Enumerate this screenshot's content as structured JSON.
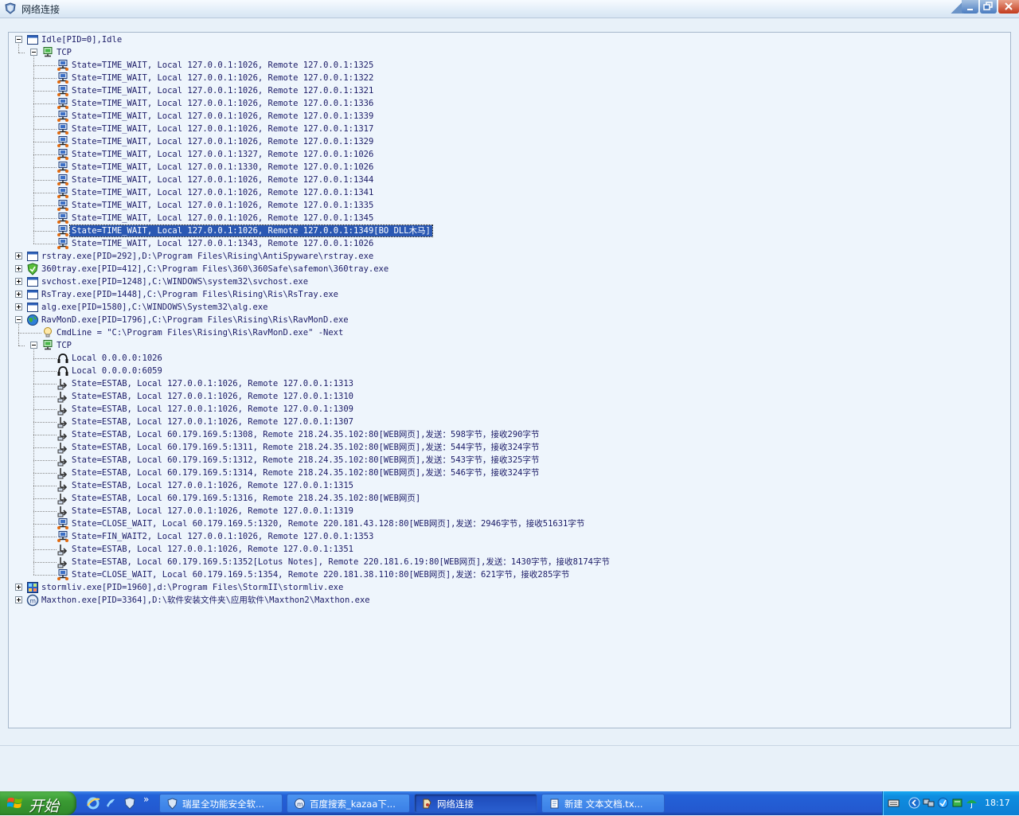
{
  "window": {
    "title": "网络连接"
  },
  "tree": [
    {
      "id": "idle",
      "depth": 0,
      "expander": "minus",
      "icon": "window-icon",
      "label": "Idle[PID=0],Idle"
    },
    {
      "id": "idle-tcp",
      "depth": 1,
      "expander": "minus",
      "icon": "network-icon",
      "label": "TCP"
    },
    {
      "depth": 2,
      "icon": "connection-icon",
      "label": "State=TIME_WAIT, Local 127.0.0.1:1026, Remote 127.0.0.1:1325"
    },
    {
      "depth": 2,
      "icon": "connection-icon",
      "label": "State=TIME_WAIT, Local 127.0.0.1:1026, Remote 127.0.0.1:1322"
    },
    {
      "depth": 2,
      "icon": "connection-icon",
      "label": "State=TIME_WAIT, Local 127.0.0.1:1026, Remote 127.0.0.1:1321"
    },
    {
      "depth": 2,
      "icon": "connection-icon",
      "label": "State=TIME_WAIT, Local 127.0.0.1:1026, Remote 127.0.0.1:1336"
    },
    {
      "depth": 2,
      "icon": "connection-icon",
      "label": "State=TIME_WAIT, Local 127.0.0.1:1026, Remote 127.0.0.1:1339"
    },
    {
      "depth": 2,
      "icon": "connection-icon",
      "label": "State=TIME_WAIT, Local 127.0.0.1:1026, Remote 127.0.0.1:1317"
    },
    {
      "depth": 2,
      "icon": "connection-icon",
      "label": "State=TIME_WAIT, Local 127.0.0.1:1026, Remote 127.0.0.1:1329"
    },
    {
      "depth": 2,
      "icon": "connection-icon",
      "label": "State=TIME_WAIT, Local 127.0.0.1:1327, Remote 127.0.0.1:1026"
    },
    {
      "depth": 2,
      "icon": "connection-icon",
      "label": "State=TIME_WAIT, Local 127.0.0.1:1330, Remote 127.0.0.1:1026"
    },
    {
      "depth": 2,
      "icon": "connection-icon",
      "label": "State=TIME_WAIT, Local 127.0.0.1:1026, Remote 127.0.0.1:1344"
    },
    {
      "depth": 2,
      "icon": "connection-icon",
      "label": "State=TIME_WAIT, Local 127.0.0.1:1026, Remote 127.0.0.1:1341"
    },
    {
      "depth": 2,
      "icon": "connection-icon",
      "label": "State=TIME_WAIT, Local 127.0.0.1:1026, Remote 127.0.0.1:1335"
    },
    {
      "depth": 2,
      "icon": "connection-icon",
      "label": "State=TIME_WAIT, Local 127.0.0.1:1026, Remote 127.0.0.1:1345"
    },
    {
      "depth": 2,
      "icon": "connection-icon",
      "label": "State=TIME_WAIT, Local 127.0.0.1:1026, Remote 127.0.0.1:1349[BO DLL木马]",
      "selected": true
    },
    {
      "depth": 2,
      "icon": "connection-icon",
      "label": "State=TIME_WAIT, Local 127.0.0.1:1343, Remote 127.0.0.1:1026"
    },
    {
      "depth": 0,
      "expander": "plus",
      "icon": "window-icon",
      "label": "rstray.exe[PID=292],D:\\Program Files\\Rising\\AntiSpyware\\rstray.exe"
    },
    {
      "depth": 0,
      "expander": "plus",
      "icon": "shield-icon",
      "label": "360tray.exe[PID=412],C:\\Program Files\\360\\360Safe\\safemon\\360tray.exe"
    },
    {
      "depth": 0,
      "expander": "plus",
      "icon": "window-icon",
      "label": "svchost.exe[PID=1248],C:\\WINDOWS\\system32\\svchost.exe"
    },
    {
      "depth": 0,
      "expander": "plus",
      "icon": "window-icon",
      "label": "RsTray.exe[PID=1448],C:\\Program Files\\Rising\\Ris\\RsTray.exe"
    },
    {
      "depth": 0,
      "expander": "plus",
      "icon": "window-icon",
      "label": "alg.exe[PID=1580],C:\\WINDOWS\\System32\\alg.exe"
    },
    {
      "id": "ravmon",
      "depth": 0,
      "expander": "minus",
      "icon": "globe-icon",
      "label": "RavMonD.exe[PID=1796],C:\\Program Files\\Rising\\Ris\\RavMonD.exe"
    },
    {
      "depth": 1,
      "icon": "lightbulb-icon",
      "label": "CmdLine = \"C:\\Program Files\\Rising\\Ris\\RavMonD.exe\" -Next"
    },
    {
      "id": "ravmon-tcp",
      "depth": 1,
      "expander": "minus",
      "icon": "network-icon",
      "label": "TCP"
    },
    {
      "depth": 2,
      "icon": "listen-icon",
      "label": "Local 0.0.0.0:1026"
    },
    {
      "depth": 2,
      "icon": "listen-icon",
      "label": "Local 0.0.0.0:6059"
    },
    {
      "depth": 2,
      "icon": "established-icon",
      "label": "State=ESTAB, Local 127.0.0.1:1026, Remote 127.0.0.1:1313"
    },
    {
      "depth": 2,
      "icon": "established-icon",
      "label": "State=ESTAB, Local 127.0.0.1:1026, Remote 127.0.0.1:1310"
    },
    {
      "depth": 2,
      "icon": "established-icon",
      "label": "State=ESTAB, Local 127.0.0.1:1026, Remote 127.0.0.1:1309"
    },
    {
      "depth": 2,
      "icon": "established-icon",
      "label": "State=ESTAB, Local 127.0.0.1:1026, Remote 127.0.0.1:1307"
    },
    {
      "depth": 2,
      "icon": "established-icon",
      "label": "State=ESTAB, Local 60.179.169.5:1308, Remote 218.24.35.102:80[WEB网页],发送：598字节，接收290字节"
    },
    {
      "depth": 2,
      "icon": "established-icon",
      "label": "State=ESTAB, Local 60.179.169.5:1311, Remote 218.24.35.102:80[WEB网页],发送：544字节，接收324字节"
    },
    {
      "depth": 2,
      "icon": "established-icon",
      "label": "State=ESTAB, Local 60.179.169.5:1312, Remote 218.24.35.102:80[WEB网页],发送：543字节，接收325字节"
    },
    {
      "depth": 2,
      "icon": "established-icon",
      "label": "State=ESTAB, Local 60.179.169.5:1314, Remote 218.24.35.102:80[WEB网页],发送：546字节，接收324字节"
    },
    {
      "depth": 2,
      "icon": "established-icon",
      "label": "State=ESTAB, Local 127.0.0.1:1026, Remote 127.0.0.1:1315"
    },
    {
      "depth": 2,
      "icon": "established-icon",
      "label": "State=ESTAB, Local 60.179.169.5:1316, Remote 218.24.35.102:80[WEB网页]"
    },
    {
      "depth": 2,
      "icon": "established-icon",
      "label": "State=ESTAB, Local 127.0.0.1:1026, Remote 127.0.0.1:1319"
    },
    {
      "depth": 2,
      "icon": "connection-icon",
      "label": "State=CLOSE_WAIT, Local 60.179.169.5:1320, Remote 220.181.43.128:80[WEB网页],发送：2946字节，接收51631字节"
    },
    {
      "depth": 2,
      "icon": "connection-icon",
      "label": "State=FIN_WAIT2, Local 127.0.0.1:1026, Remote 127.0.0.1:1353"
    },
    {
      "depth": 2,
      "icon": "established-icon",
      "label": "State=ESTAB, Local 127.0.0.1:1026, Remote 127.0.0.1:1351"
    },
    {
      "depth": 2,
      "icon": "established-icon",
      "label": "State=ESTAB, Local 60.179.169.5:1352[Lotus Notes], Remote 220.181.6.19:80[WEB网页],发送：1430字节，接收8174字节"
    },
    {
      "depth": 2,
      "icon": "connection-icon",
      "label": "State=CLOSE_WAIT, Local 60.179.169.5:1354, Remote 220.181.38.110:80[WEB网页],发送：621字节，接收285字节"
    },
    {
      "depth": 0,
      "expander": "plus",
      "icon": "media-icon",
      "label": "stormliv.exe[PID=1960],d:\\Program Files\\StormII\\stormliv.exe"
    },
    {
      "depth": 0,
      "expander": "plus",
      "icon": "browser-icon",
      "label": "Maxthon.exe[PID=3364],D:\\软件安装文件夹\\应用软件\\Maxthon2\\Maxthon.exe"
    }
  ],
  "taskbar": {
    "start_label": "开始",
    "buttons": [
      {
        "label": "瑞星全功能安全软...",
        "icon": "rising-icon",
        "active": false
      },
      {
        "label": "百度搜索_kazaa下...",
        "icon": "maxthon-icon",
        "active": false
      },
      {
        "label": "网络连接",
        "icon": "network-app-icon",
        "active": true
      },
      {
        "label": "新建 文本文档.tx...",
        "icon": "notepad-icon",
        "active": false
      }
    ],
    "quicklaunch_more": "»",
    "clock": "18:17"
  }
}
